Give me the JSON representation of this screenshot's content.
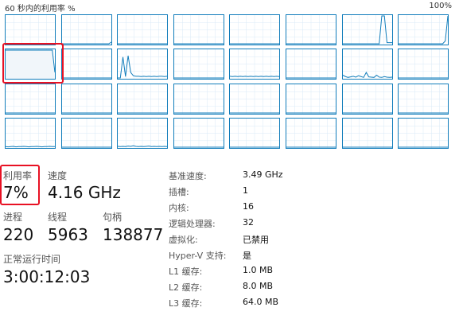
{
  "header": {
    "left_label": "60 秒内的利用率 %",
    "right_label": "100%"
  },
  "colors": {
    "line": "#117dbb",
    "fill": "#f1f6fa",
    "highlight": "#e81123",
    "border": "#117dbb"
  },
  "graphs": [
    {
      "fill": false,
      "samples": [
        0,
        0,
        0,
        0,
        0,
        0,
        0,
        0,
        0,
        0,
        0,
        0,
        0,
        0,
        0,
        0,
        0,
        0,
        0,
        0
      ]
    },
    {
      "fill": false,
      "samples": [
        0,
        0,
        0,
        0,
        0,
        0,
        0,
        0,
        0,
        0,
        0,
        0,
        0,
        0,
        0,
        0,
        0,
        0,
        0,
        6
      ]
    },
    {
      "fill": false,
      "samples": [
        0,
        0,
        0,
        0,
        0,
        0,
        0,
        0,
        0,
        0,
        0,
        0,
        0,
        0,
        0,
        0,
        0,
        0,
        0,
        0
      ]
    },
    {
      "fill": false,
      "samples": [
        0,
        0,
        0,
        0,
        0,
        0,
        0,
        0,
        0,
        0,
        0,
        0,
        0,
        0,
        0,
        0,
        0,
        0,
        0,
        0
      ]
    },
    {
      "fill": false,
      "samples": [
        0,
        0,
        0,
        0,
        0,
        0,
        0,
        0,
        0,
        0,
        0,
        0,
        0,
        0,
        0,
        0,
        0,
        0,
        0,
        0
      ]
    },
    {
      "fill": false,
      "samples": [
        0,
        0,
        0,
        0,
        0,
        0,
        0,
        0,
        0,
        0,
        0,
        0,
        0,
        0,
        0,
        0,
        0,
        0,
        0,
        0
      ]
    },
    {
      "fill": false,
      "samples": [
        0,
        0,
        0,
        0,
        0,
        0,
        0,
        0,
        0,
        0,
        0,
        0,
        0,
        0,
        0,
        100,
        100,
        4,
        4,
        4
      ]
    },
    {
      "fill": false,
      "samples": [
        0,
        0,
        0,
        0,
        0,
        0,
        0,
        0,
        0,
        0,
        0,
        0,
        0,
        0,
        0,
        0,
        0,
        0,
        10,
        100
      ]
    },
    {
      "fill": true,
      "samples": [
        100,
        100,
        100,
        100,
        100,
        100,
        100,
        100,
        100,
        100,
        100,
        100,
        100,
        100,
        100,
        100,
        100,
        100,
        100,
        20
      ]
    },
    {
      "fill": false,
      "samples": [
        0,
        0,
        0,
        0,
        0,
        0,
        0,
        0,
        0,
        0,
        0,
        0,
        0,
        0,
        0,
        0,
        0,
        0,
        0,
        0
      ]
    },
    {
      "fill": false,
      "samples": [
        0,
        0,
        75,
        5,
        80,
        20,
        8,
        6,
        6,
        5,
        6,
        5,
        6,
        5,
        6,
        5,
        6,
        6,
        5,
        6
      ]
    },
    {
      "fill": false,
      "samples": [
        0,
        0,
        0,
        0,
        0,
        0,
        0,
        0,
        0,
        0,
        0,
        0,
        0,
        0,
        0,
        0,
        0,
        0,
        0,
        0
      ]
    },
    {
      "fill": false,
      "samples": [
        6,
        5,
        6,
        5,
        6,
        5,
        6,
        5,
        6,
        5,
        6,
        5,
        6,
        5,
        6,
        5,
        6,
        5,
        6,
        5
      ]
    },
    {
      "fill": false,
      "samples": [
        0,
        0,
        0,
        0,
        0,
        0,
        0,
        0,
        0,
        0,
        0,
        0,
        0,
        0,
        0,
        0,
        0,
        0,
        0,
        0
      ]
    },
    {
      "fill": false,
      "samples": [
        10,
        5,
        2,
        4,
        6,
        3,
        8,
        5,
        2,
        20,
        4,
        3,
        2,
        10,
        3,
        2,
        5,
        3,
        2,
        3
      ]
    },
    {
      "fill": false,
      "samples": [
        0,
        0,
        0,
        0,
        0,
        0,
        0,
        0,
        0,
        0,
        0,
        0,
        0,
        0,
        0,
        0,
        0,
        0,
        0,
        0
      ]
    },
    {
      "fill": false,
      "samples": [
        0,
        0,
        0,
        0,
        0,
        0,
        0,
        0,
        0,
        0,
        0,
        0,
        0,
        0,
        0,
        0,
        0,
        0,
        0,
        0
      ]
    },
    {
      "fill": false,
      "samples": [
        0,
        0,
        0,
        0,
        0,
        0,
        0,
        0,
        0,
        0,
        0,
        0,
        0,
        0,
        0,
        0,
        0,
        0,
        0,
        0
      ]
    },
    {
      "fill": false,
      "samples": [
        0,
        0,
        0,
        0,
        0,
        0,
        0,
        0,
        0,
        0,
        0,
        0,
        0,
        0,
        0,
        0,
        0,
        0,
        0,
        0
      ]
    },
    {
      "fill": false,
      "samples": [
        0,
        0,
        0,
        0,
        0,
        0,
        0,
        0,
        0,
        0,
        0,
        0,
        0,
        0,
        0,
        0,
        0,
        0,
        0,
        0
      ]
    },
    {
      "fill": false,
      "samples": [
        0,
        0,
        0,
        0,
        0,
        0,
        0,
        0,
        0,
        0,
        0,
        0,
        0,
        0,
        0,
        0,
        0,
        0,
        0,
        0
      ]
    },
    {
      "fill": false,
      "samples": [
        0,
        0,
        0,
        0,
        0,
        0,
        0,
        0,
        0,
        0,
        0,
        0,
        0,
        0,
        0,
        0,
        0,
        0,
        0,
        0
      ]
    },
    {
      "fill": false,
      "samples": [
        0,
        0,
        0,
        0,
        0,
        0,
        0,
        0,
        0,
        0,
        0,
        0,
        0,
        0,
        0,
        0,
        0,
        0,
        0,
        0
      ]
    },
    {
      "fill": false,
      "samples": [
        0,
        0,
        0,
        0,
        0,
        0,
        0,
        0,
        0,
        0,
        0,
        0,
        0,
        0,
        0,
        0,
        0,
        0,
        0,
        0
      ]
    },
    {
      "fill": false,
      "samples": [
        2,
        1,
        2,
        3,
        1,
        2,
        2,
        3,
        2,
        1,
        2,
        2,
        3,
        2,
        1,
        2,
        2,
        3,
        2,
        2
      ]
    },
    {
      "fill": false,
      "samples": [
        0,
        0,
        0,
        0,
        0,
        0,
        0,
        0,
        0,
        0,
        0,
        0,
        0,
        0,
        0,
        0,
        0,
        0,
        0,
        0
      ]
    },
    {
      "fill": false,
      "samples": [
        3,
        2,
        3,
        2,
        4,
        3,
        5,
        3,
        2,
        3,
        2,
        3,
        4,
        2,
        3,
        2,
        3,
        2,
        3,
        2
      ]
    },
    {
      "fill": false,
      "samples": [
        0,
        0,
        0,
        0,
        0,
        0,
        0,
        0,
        0,
        0,
        0,
        0,
        0,
        0,
        0,
        0,
        0,
        0,
        0,
        0
      ]
    },
    {
      "fill": false,
      "samples": [
        0,
        0,
        0,
        0,
        0,
        0,
        0,
        0,
        0,
        0,
        0,
        0,
        0,
        0,
        0,
        0,
        0,
        0,
        0,
        0
      ]
    },
    {
      "fill": false,
      "samples": [
        0,
        0,
        0,
        0,
        0,
        0,
        0,
        0,
        0,
        0,
        0,
        0,
        0,
        0,
        0,
        0,
        0,
        0,
        0,
        0
      ]
    },
    {
      "fill": false,
      "samples": [
        0,
        0,
        0,
        0,
        0,
        0,
        0,
        0,
        0,
        0,
        0,
        0,
        0,
        0,
        0,
        0,
        0,
        0,
        0,
        0
      ]
    },
    {
      "fill": false,
      "samples": [
        0,
        0,
        0,
        0,
        0,
        0,
        0,
        0,
        0,
        0,
        0,
        0,
        0,
        0,
        0,
        0,
        0,
        0,
        0,
        0
      ]
    }
  ],
  "stats": {
    "utilization": {
      "label": "利用率",
      "value": "7%"
    },
    "speed": {
      "label": "速度",
      "value": "4.16 GHz"
    },
    "processes": {
      "label": "进程",
      "value": "220"
    },
    "threads": {
      "label": "线程",
      "value": "5963"
    },
    "handles": {
      "label": "句柄",
      "value": "138877"
    },
    "uptime": {
      "label": "正常运行时间",
      "value": "3:00:12:03"
    }
  },
  "details": [
    {
      "key": "基准速度:",
      "value": "3.49 GHz"
    },
    {
      "key": "插槽:",
      "value": "1"
    },
    {
      "key": "内核:",
      "value": "16"
    },
    {
      "key": "逻辑处理器:",
      "value": "32"
    },
    {
      "key": "虚拟化:",
      "value": "已禁用"
    },
    {
      "key": "Hyper-V 支持:",
      "value": "是"
    },
    {
      "key": "L1 缓存:",
      "value": "1.0 MB"
    },
    {
      "key": "L2 缓存:",
      "value": "8.0 MB"
    },
    {
      "key": "L3 缓存:",
      "value": "64.0 MB"
    }
  ]
}
